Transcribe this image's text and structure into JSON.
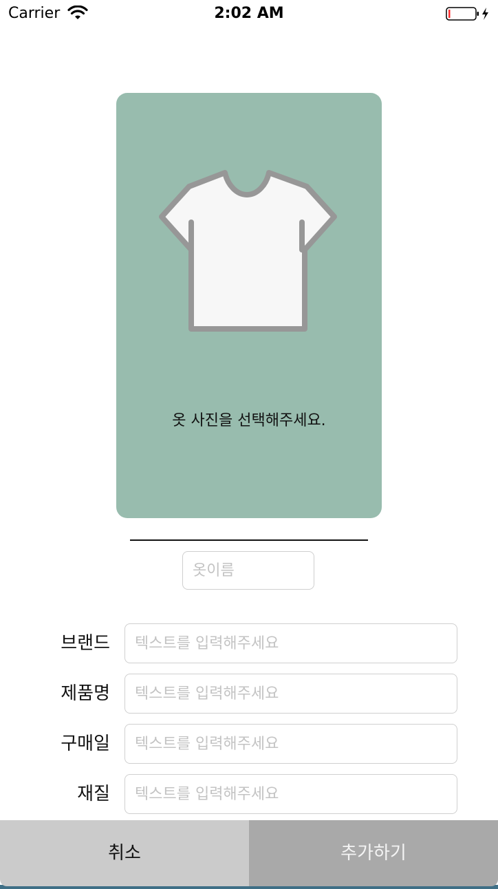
{
  "status_bar": {
    "carrier": "Carrier",
    "time": "2:02 AM",
    "icons": [
      "wifi-icon",
      "battery-icon",
      "charging-bolt-icon"
    ],
    "battery_level_fraction": 0.05
  },
  "photo_card": {
    "icon": "tshirt-icon",
    "prompt": "옷 사진을 선택해주세요.",
    "background_color": "#98bcae"
  },
  "name_field": {
    "placeholder": "옷이름",
    "value": ""
  },
  "form": {
    "rows": [
      {
        "label": "브랜드",
        "placeholder": "텍스트를 입력해주세요",
        "value": ""
      },
      {
        "label": "제품명",
        "placeholder": "텍스트를 입력해주세요",
        "value": ""
      },
      {
        "label": "구매일",
        "placeholder": "텍스트를 입력해주세요",
        "value": ""
      },
      {
        "label": "재질",
        "placeholder": "텍스트를 입력해주세요",
        "value": ""
      }
    ]
  },
  "buttons": {
    "cancel_label": "취소",
    "add_label": "추가하기",
    "cancel_color": "#cbcbcb",
    "add_color": "#a9a9a9"
  }
}
